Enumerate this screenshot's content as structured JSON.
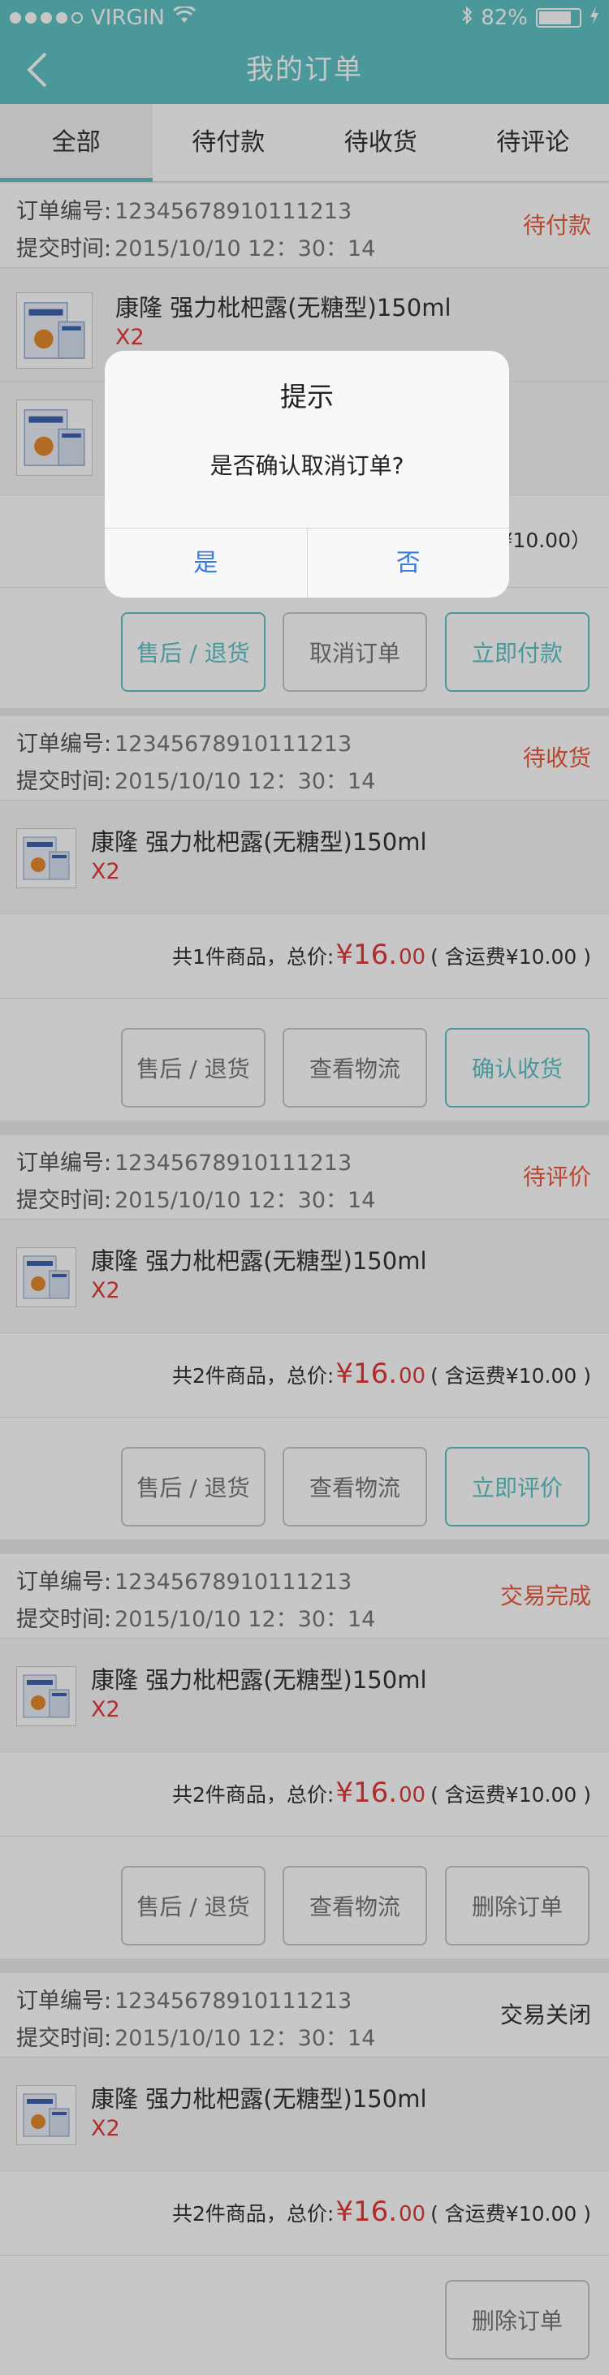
{
  "status_bar": {
    "carrier": "VIRGIN",
    "battery": "82%",
    "battery_level": 0.82
  },
  "nav": {
    "title": "我的订单"
  },
  "tabs": [
    {
      "label": "全部",
      "active": true
    },
    {
      "label": "待付款",
      "active": false
    },
    {
      "label": "待收货",
      "active": false
    },
    {
      "label": "待评论",
      "active": false
    }
  ],
  "order_labels": {
    "number": "订单编号:",
    "time": "提交时间:"
  },
  "orders": [
    {
      "number": "12345678910111213",
      "time": "2015/10/10  12：30：14",
      "status": "待付款",
      "items": [
        {
          "name": "康隆 强力枇杷露(无糖型)150ml",
          "qty": "X2"
        },
        {
          "name": "",
          "qty": ""
        }
      ],
      "summary": {
        "prefix": "",
        "price": "",
        "cents": "",
        "shipping": "¥10.00）"
      },
      "actions": [
        "售后 / 退货",
        "取消订单",
        "立即付款"
      ]
    },
    {
      "number": "12345678910111213",
      "time": "2015/10/10  12：30：14",
      "status": "待收货",
      "items": [
        {
          "name": "康隆 强力枇杷露(无糖型)150ml",
          "qty": "X2"
        }
      ],
      "summary": {
        "prefix": "共1件商品，总价:",
        "price": "¥16.",
        "cents": "00",
        "shipping": "( 含运费¥10.00 )"
      },
      "actions": [
        "售后 / 退货",
        "查看物流",
        "确认收货"
      ]
    },
    {
      "number": "12345678910111213",
      "time": "2015/10/10  12：30：14",
      "status": "待评价",
      "items": [
        {
          "name": "康隆 强力枇杷露(无糖型)150ml",
          "qty": "X2"
        }
      ],
      "summary": {
        "prefix": "共2件商品，总价:",
        "price": "¥16.",
        "cents": "00",
        "shipping": "( 含运费¥10.00 )"
      },
      "actions": [
        "售后 / 退货",
        "查看物流",
        "立即评价"
      ]
    },
    {
      "number": "12345678910111213",
      "time": "2015/10/10  12：30：14",
      "status": "交易完成",
      "items": [
        {
          "name": "康隆 强力枇杷露(无糖型)150ml",
          "qty": "X2"
        }
      ],
      "summary": {
        "prefix": "共2件商品，总价:",
        "price": "¥16.",
        "cents": "00",
        "shipping": "( 含运费¥10.00 )"
      },
      "actions": [
        "售后 / 退货",
        "查看物流",
        "删除订单"
      ]
    },
    {
      "number": "12345678910111213",
      "time": "2015/10/10  12：30：14",
      "status": "交易关闭",
      "items": [
        {
          "name": "康隆 强力枇杷露(无糖型)150ml",
          "qty": "X2"
        }
      ],
      "summary": {
        "prefix": "共2件商品，总价:",
        "price": "¥16.",
        "cents": "00",
        "shipping": "( 含运费¥10.00 )"
      },
      "actions": [
        "删除订单"
      ]
    }
  ],
  "dialog": {
    "title": "提示",
    "message": "是否确认取消订单?",
    "confirm": "是",
    "cancel": "否"
  },
  "colors": {
    "accent": "#5fc3c5",
    "price": "#e03a3a",
    "status": "#ec5a3f",
    "dialog_button": "#3a7be0"
  }
}
